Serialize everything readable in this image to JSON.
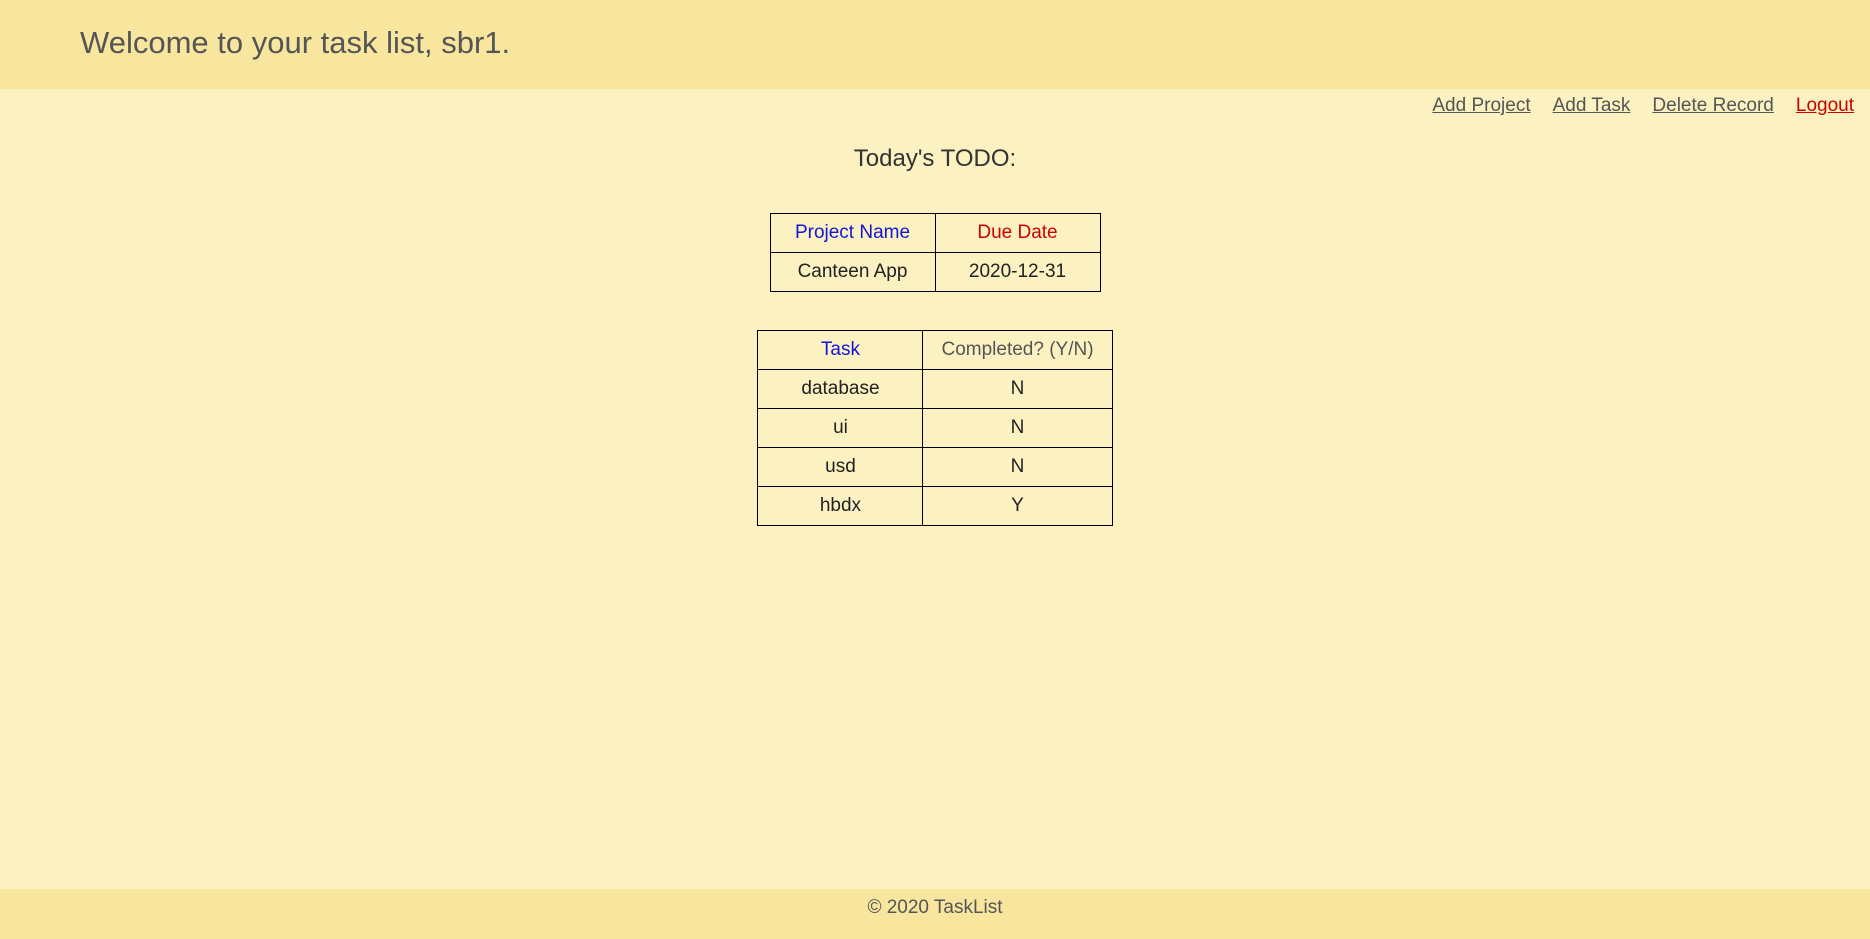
{
  "header": {
    "welcome": "Welcome to your task list, sbr1."
  },
  "nav": {
    "add_project": "Add Project",
    "add_task": "Add Task",
    "delete_record": "Delete Record",
    "logout": "Logout"
  },
  "main": {
    "title": "Today's TODO:",
    "projects_table": {
      "headers": {
        "project_name": "Project Name",
        "due_date": "Due Date"
      },
      "rows": [
        {
          "name": "Canteen App",
          "due": "2020-12-31"
        }
      ]
    },
    "tasks_table": {
      "headers": {
        "task": "Task",
        "completed": "Completed? (Y/N)"
      },
      "rows": [
        {
          "task": "database",
          "completed": "N"
        },
        {
          "task": "ui",
          "completed": "N"
        },
        {
          "task": "usd",
          "completed": "N"
        },
        {
          "task": "hbdx",
          "completed": "Y"
        }
      ]
    }
  },
  "footer": {
    "text": "© 2020 TaskList"
  }
}
